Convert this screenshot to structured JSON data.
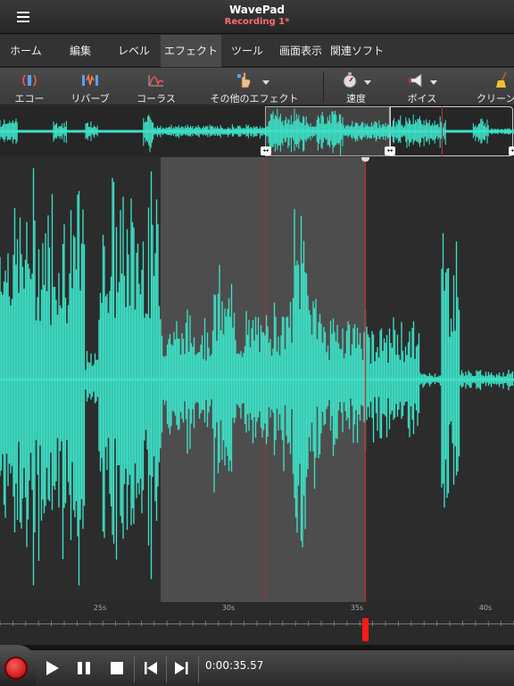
{
  "header": {
    "app_title": "WavePad",
    "doc_title": "Recording 1*"
  },
  "tabs": [
    {
      "label": "ホーム"
    },
    {
      "label": "編集"
    },
    {
      "label": "レベル"
    },
    {
      "label": "エフェクト",
      "active": true
    },
    {
      "label": "ツール"
    },
    {
      "label": "画面表示"
    },
    {
      "label": "関連ソフト"
    }
  ],
  "toolbar": {
    "echo": "エコー",
    "reverb": "リバーブ",
    "chorus": "コーラス",
    "other_effects": "その他のエフェクト",
    "speed": "速度",
    "voice": "ボイス",
    "clean": "クリーン"
  },
  "ruler": {
    "labels": [
      "25s",
      "30s",
      "35s",
      "40s"
    ]
  },
  "transport": {
    "time": "0:00:35.57"
  },
  "colors": {
    "waveform": "#3de0c6",
    "cursor": "#e02020",
    "accent_title": "#ff6b6b"
  }
}
